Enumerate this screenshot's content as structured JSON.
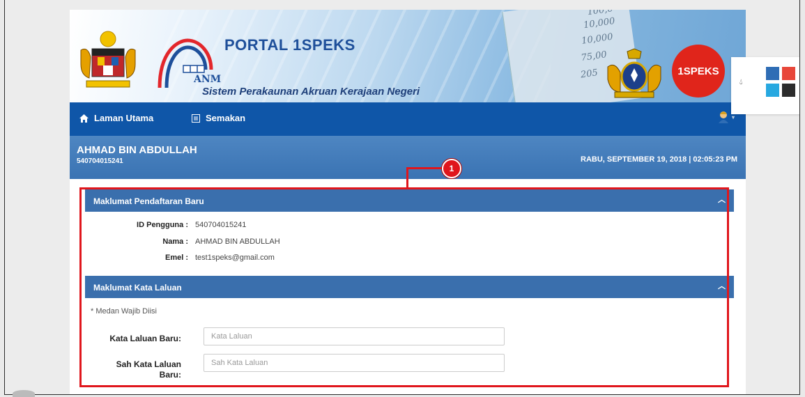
{
  "banner": {
    "title": "PORTAL 1SPEKS",
    "anm": "ANM",
    "subtitle": "Sistem Perakaunan Akruan Kerajaan Negeri",
    "badge": "1SPEKS",
    "paper_numbers": [
      "100,0",
      "10,000",
      "10,000",
      "75,00",
      "205"
    ]
  },
  "nav": {
    "home_icon": "home-icon",
    "home": "Laman Utama",
    "semakan_icon": "list-icon",
    "semakan": "Semakan",
    "user_icon": "user-avatar-icon"
  },
  "userbar": {
    "name": "AHMAD BIN ABDULLAH",
    "ic": "540704015241",
    "datetime": "RABU, SEPTEMBER 19, 2018 | 02:05:23 PM"
  },
  "registration": {
    "title": "Maklumat Pendaftaran Baru",
    "fields": [
      {
        "label": "ID Pengguna :",
        "value": "540704015241"
      },
      {
        "label": "Nama :",
        "value": "AHMAD BIN ABDULLAH"
      },
      {
        "label": "Emel :",
        "value": "test1speks@gmail.com"
      }
    ]
  },
  "password": {
    "title": "Maklumat Kata Laluan",
    "note": "* Medan Wajib Diisi",
    "new_label": "Kata Laluan Baru:",
    "new_placeholder": "Kata Laluan",
    "confirm_label_1": "Sah Kata Laluan",
    "confirm_label_2": "Baru:",
    "confirm_placeholder": "Sah Kata Laluan"
  },
  "annotation": {
    "number": "1"
  },
  "theme": {
    "nav": "#0f56a8",
    "section": "#3a6fad",
    "accent": "#e0161c",
    "swatches": [
      "#2f6db5",
      "#e8473a",
      "#27a8e0",
      "#2c2c2c"
    ]
  }
}
